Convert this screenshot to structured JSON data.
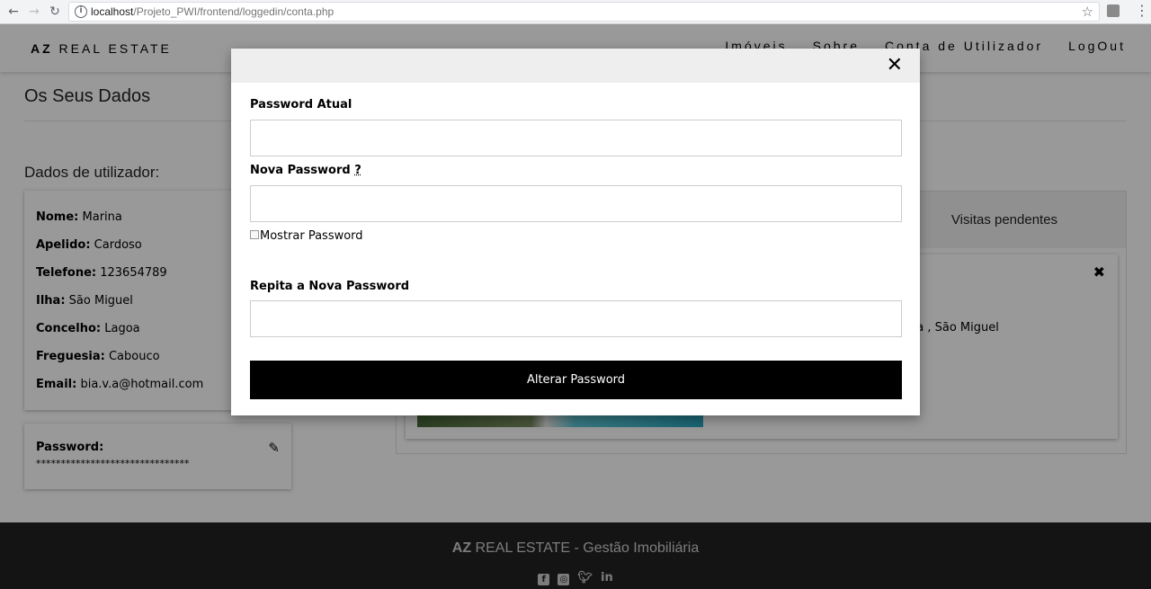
{
  "browser": {
    "url_host": "localhost",
    "url_path": "/Projeto_PWI/frontend/loggedin/conta.php"
  },
  "nav": {
    "brand_bold": "AZ",
    "brand_rest": " REAL ESTATE",
    "links": [
      "Imóveis",
      "Sobre",
      "Conta de Utilizador",
      "LogOut"
    ]
  },
  "page": {
    "title": "Os Seus Dados",
    "section_label": "Dados de utilizador:"
  },
  "user": {
    "fields": [
      {
        "label": "Nome:",
        "value": "Marina"
      },
      {
        "label": "Apelido:",
        "value": "Cardoso"
      },
      {
        "label": "Telefone:",
        "value": "123654789"
      },
      {
        "label": "Ilha:",
        "value": "São Miguel"
      },
      {
        "label": "Concelho:",
        "value": "Lagoa"
      },
      {
        "label": "Freguesia:",
        "value": "Cabouco"
      },
      {
        "label": "Email:",
        "value": "bia.v.a@hotmail.com"
      }
    ],
    "password_label": "Password:",
    "password_masked": "*******************************"
  },
  "visits": {
    "tab_label": "Visitas pendentes",
    "location_fragment": "da , São Miguel"
  },
  "footer": {
    "brand_bold": "AZ",
    "brand_rest": " REAL ESTATE - Gestão Imobiliária"
  },
  "modal": {
    "current_pw_label": "Password Atual",
    "new_pw_label": "Nova Password",
    "help_mark": "?",
    "show_pw_label": "Mostrar Password",
    "repeat_pw_label": "Repita a Nova Password",
    "submit_label": "Alterar Password",
    "close_glyph": "✕"
  },
  "icons": {
    "nav_back": "arrow-left-icon",
    "nav_forward": "arrow-right-icon",
    "reload": "reload-icon",
    "info": "info-icon",
    "star": "star-icon",
    "pencil": "pencil-icon",
    "close": "close-icon",
    "facebook": "facebook-icon",
    "instagram": "instagram-icon",
    "twitter": "twitter-icon",
    "linkedin": "linkedin-icon"
  },
  "colors": {
    "navbar_bg": "#ffffff",
    "footer_bg": "#222222",
    "button_bg": "#000000",
    "overlay": "rgba(0,0,0,0.4)"
  }
}
